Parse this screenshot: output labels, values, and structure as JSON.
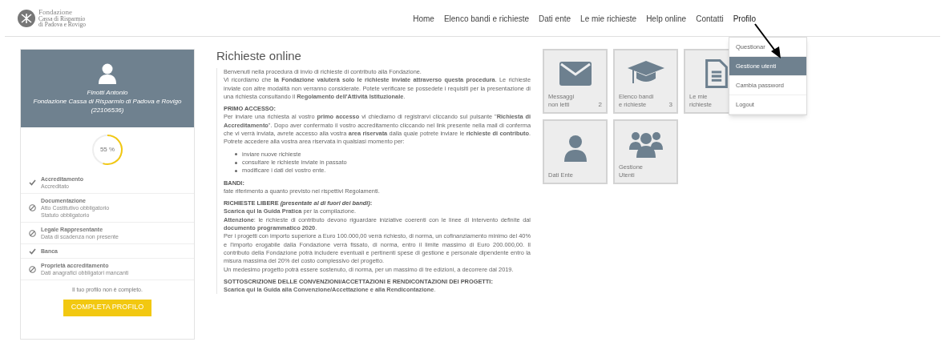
{
  "logo": {
    "title": "Fondazione",
    "subtitle_1": "Cassa di Risparmio",
    "subtitle_2": "di Padova e Rovigo"
  },
  "nav": [
    {
      "label": "Home",
      "selected": false
    },
    {
      "label": "Elenco bandi e richieste",
      "selected": false
    },
    {
      "label": "Dati ente",
      "selected": false
    },
    {
      "label": "Le mie richieste",
      "selected": false
    },
    {
      "label": "Help online",
      "selected": false
    },
    {
      "label": "Contatti",
      "selected": false
    },
    {
      "label": "Profilo",
      "selected": true
    }
  ],
  "profile_menu": [
    {
      "label": "Questionar",
      "selected": false
    },
    {
      "label": "Gestione utenti",
      "selected": true
    },
    {
      "label": "Cambia password",
      "selected": false
    },
    {
      "label": "Logout",
      "selected": false
    }
  ],
  "profile": {
    "name": "Finotti Antonio",
    "organization": "Fondazione Cassa di Risparmio di Padova e Rovigo",
    "code": "(22106536)",
    "progress": {
      "level": 0.55,
      "reading": "55 %"
    },
    "steps": [
      {
        "title": "Accreditamento",
        "details": [
          "Accreditato"
        ],
        "complete": true
      },
      {
        "title": "Documentazione",
        "details": [
          "Atto Costitutivo obbligatorio",
          "Statuto obbligatorio"
        ],
        "complete": false
      },
      {
        "title": "Legale Rappresentante",
        "details": [
          "Data di scadenza non presente"
        ],
        "complete": false
      },
      {
        "title": "Banca",
        "complete": true
      },
      {
        "title": "Proprietà accreditamento",
        "details": [
          "Dati anagrafici obbligatori mancanti"
        ],
        "complete": false
      }
    ],
    "notice": "Il tuo profilo non è completo.",
    "button": "COMPLETA PROFILO"
  },
  "content": {
    "title": "Richieste online",
    "blocks": [
      {
        "kind": "paragraph",
        "lines": [
          "Benvenuti nella procedura di invio di richieste di contributo alla Fondazione.",
          "Vi ricordiamo che **la Fondazione valuterà solo le richieste inviate attraverso questa procedura**. Le richieste inviate con altre modalità non verranno considerate. Potete verificare se possedete i requisiti per la presentazione di una richiesta consultando il **Regolamento dell'Attività Istituzionale**."
        ]
      },
      {
        "kind": "heading",
        "lines": [
          "PRIMO ACCESSO:"
        ]
      },
      {
        "kind": "paragraph",
        "lines": [
          "Per inviare una richiesta al vostro **primo accesso** vi chiediamo di registrarvi cliccando sul pulsante \"**Richiesta di Accreditamento**\". Dopo aver confermato il vostro accreditamento cliccando nel link presente nella mail di conferma che vi verrà inviata, avrete accesso alla vostra **area riservata** dalla quale potrete inviare le **richieste di contributo**. Potrete accedere alla vostra area riservata in qualsiasi momento per:"
        ]
      },
      {
        "kind": "list",
        "lines": [
          "inviare nuove richieste",
          "consultare le richieste inviate in passato",
          "modificare i dati del vostro ente."
        ]
      },
      {
        "kind": "heading",
        "lines": [
          "BANDI:"
        ]
      },
      {
        "kind": "paragraph",
        "lines": [
          "fate riferimento a quanto previsto nei rispettivi Regolamenti."
        ]
      },
      {
        "kind": "heading",
        "lines": [
          "RICHIESTE LIBERE *(presentate al di fuori dei bandi)*:"
        ]
      },
      {
        "kind": "paragraph",
        "lines": [
          "**Scarica qui la Guida Pratica** per la compilazione.",
          "**Attenzione**: le richieste di contributo devono riguardare iniziative coerenti con le linee di intervento definite dal **documento programmatico 2020**.",
          "Per i progetti con importo superiore a Euro 100.000,00 verrà richiesto, di norma, un cofinanziamento minimo del 40% e l'importo erogabile dalla Fondazione verrà fissato, di norma, entro il limite massimo di Euro 200.000,00. Il contributo della Fondazione potrà includere eventuali e pertinenti spese di gestione e personale dipendente entro la misura massima del 20% del costo complessivo del progetto.",
          "Un medesimo progetto potrà essere sostenuto, di norma, per un massimo di tre edizioni, a decorrere dal 2019."
        ]
      },
      {
        "kind": "heading",
        "lines": [
          "SOTTOSCRIZIONE DELLE CONVENZIONI/ACCETTAZIONI E RENDICONTAZIONI DEI PROGETTI:"
        ]
      },
      {
        "kind": "paragraph",
        "lines": [
          "**Scarica qui la Guida alla Convenzione/Accettazione e alla Rendicontazione**."
        ]
      }
    ]
  },
  "tiles": [
    {
      "kind": "mail",
      "label": "Messaggi non letti",
      "count": "2"
    },
    {
      "kind": "cap",
      "label": "Elenco bandi e richieste",
      "count": "3"
    },
    {
      "kind": "doc",
      "label": "Le mie richieste"
    },
    {
      "kind": "person",
      "label": "Dati Ente"
    },
    {
      "kind": "group",
      "label": "Gestione Utenti"
    }
  ]
}
